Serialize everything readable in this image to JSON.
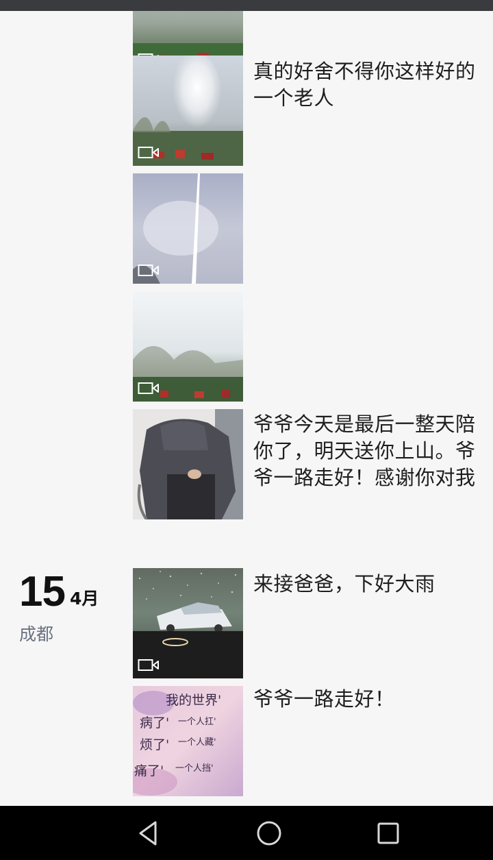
{
  "posts": [
    {
      "caption": "",
      "has_video": true,
      "image": "video-thumbnail-field"
    },
    {
      "caption": "真的好舍不得你这样好的一个老人",
      "has_video": true,
      "image": "video-thumbnail-fireworks-smoke"
    },
    {
      "caption": "",
      "has_video": true,
      "image": "video-thumbnail-firework-trail"
    },
    {
      "caption": "",
      "has_video": true,
      "image": "video-thumbnail-sky-trees"
    },
    {
      "caption": "爷爷今天是最后一整天陪你了，明天送你上山。爷爷一路走好！感谢你对我这么...",
      "has_video": false,
      "image": "photo-elderly-person-wheelchair"
    }
  ],
  "date_group": {
    "day": "15",
    "month": "4月",
    "location": "成都"
  },
  "posts_group2": [
    {
      "caption": "来接爸爸，下好大雨",
      "has_video": true,
      "image": "video-thumbnail-rainy-car"
    },
    {
      "caption": "爷爷一路走好！",
      "has_video": false,
      "image": "text-image"
    }
  ],
  "text_image_lines": [
    "我的世界'",
    "病了'",
    "一个人扛'",
    "烦了'",
    "一个人藏'",
    "痛了'",
    "一个人挡'"
  ],
  "nav": {
    "back": "back-triangle-icon",
    "home": "home-circle-icon",
    "recents": "recents-square-icon"
  },
  "colors": {
    "background": "#f6f6f6",
    "status_bar": "#3a3b3f",
    "nav_bar": "#000000",
    "location_text": "#6b7182"
  }
}
